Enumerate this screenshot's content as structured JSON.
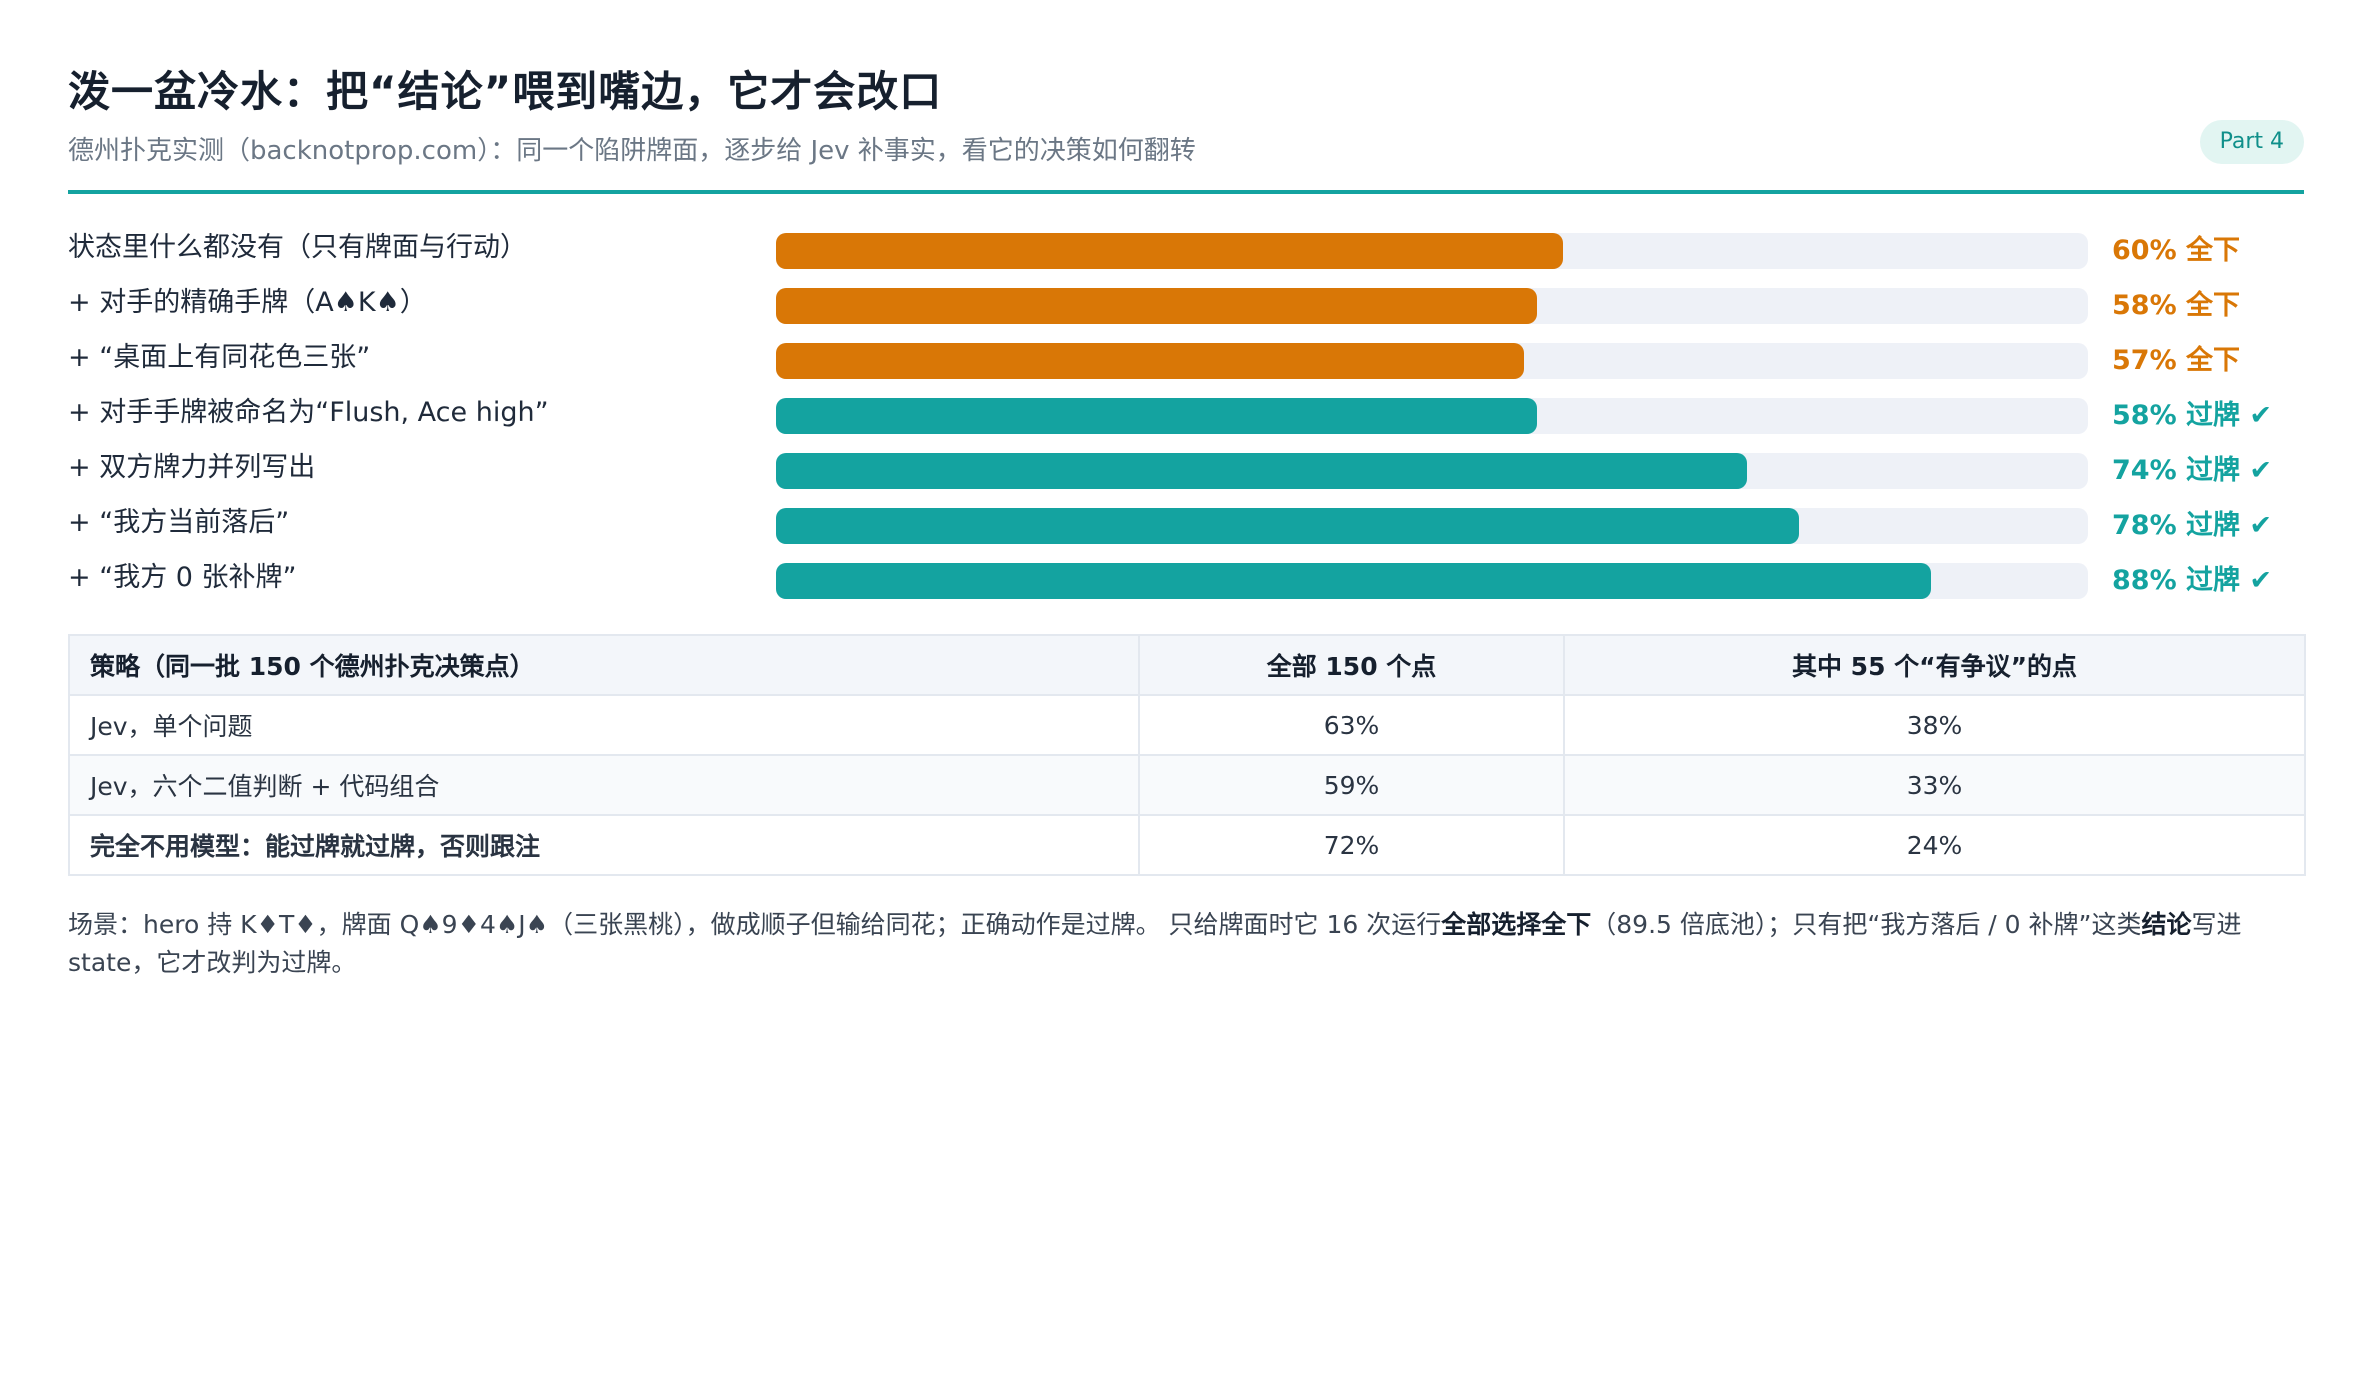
{
  "header": {
    "title": "泼一盆冷水：把“结论”喂到嘴边，它才会改口",
    "subtitle": "德州扑克实测（backnotprop.com）：同一个陷阱牌面，逐步给 Jev 补事实，看它的决策如何翻转",
    "badge": "Part 4"
  },
  "colors": {
    "shove": "#d97706",
    "check": "#14a3a0",
    "track": "#eef1f7",
    "accent": "#14a3a0"
  },
  "chart_data": {
    "type": "bar",
    "orientation": "horizontal",
    "categories": [
      "状态里什么都没有（只有牌面与行动）",
      "+ 对手的精确手牌（A♠K♠）",
      "+ “桌面上有同花色三张”",
      "+ 对手手牌被命名为“Flush, Ace high”",
      "+ 双方牌力并列写出",
      "+ “我方当前落后”",
      "+ “我方 0 张补牌”"
    ],
    "values": [
      60,
      58,
      57,
      58,
      74,
      78,
      88
    ],
    "value_labels": [
      "60% 全下",
      "58% 全下",
      "57% 全下",
      "58% 过牌 ✔",
      "74% 过牌 ✔",
      "78% 过牌 ✔",
      "88% 过牌 ✔"
    ],
    "decision": [
      "shove",
      "shove",
      "shove",
      "check",
      "check",
      "check",
      "check"
    ],
    "xlim": [
      0,
      100
    ],
    "unit": "%"
  },
  "table": {
    "headers": [
      "策略（同一批 150 个德州扑克决策点）",
      "全部 150 个点",
      "其中 55 个“有争议”的点"
    ],
    "rows": [
      [
        "Jev，单个问题",
        "63%",
        "38%"
      ],
      [
        "Jev，六个二值判断 + 代码组合",
        "59%",
        "33%"
      ],
      [
        "完全不用模型：能过牌就过牌，否则跟注",
        "72%",
        "24%"
      ]
    ]
  },
  "note": {
    "p1": "场景：hero 持 K♦T♦，牌面 Q♠9♦4♠J♠（三张黑桃），做成顺子但输给同花；正确动作是过牌。 只给牌面时它 16 次运行",
    "b1": "全部选择全下",
    "p2": "（89.5 倍底池）；只有把“我方落后 / 0 补牌”这类",
    "b2": "结论",
    "p3": "写进 state，它才改判为过牌。"
  }
}
